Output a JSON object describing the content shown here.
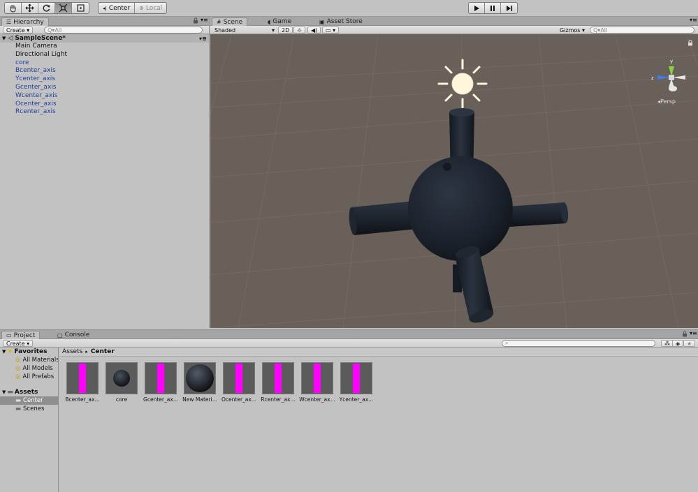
{
  "toolbar": {
    "tools": [
      {
        "name": "hand-tool-button",
        "icon": "hand-icon"
      },
      {
        "name": "move-tool-button",
        "icon": "move-arrows-icon"
      },
      {
        "name": "rotate-tool-button",
        "icon": "rotate-icon"
      },
      {
        "name": "scale-tool-button",
        "icon": "scale-icon"
      },
      {
        "name": "rect-tool-button",
        "icon": "rect-tool-icon"
      }
    ],
    "pivot_label": "Center",
    "space_label": "Local"
  },
  "hierarchy": {
    "tab_label": "Hierarchy",
    "create_label": "Create",
    "search_placeholder": "Q▾All",
    "scene_name": "SampleScene*",
    "items": [
      {
        "label": "Main Camera",
        "prefab": false
      },
      {
        "label": "Directional Light",
        "prefab": false
      },
      {
        "label": "core",
        "prefab": true
      },
      {
        "label": "Bcenter_axis",
        "prefab": true
      },
      {
        "label": "Ycenter_axis",
        "prefab": true
      },
      {
        "label": "Gcenter_axis",
        "prefab": true
      },
      {
        "label": "Wcenter_axis",
        "prefab": true
      },
      {
        "label": "Ocenter_axis",
        "prefab": true
      },
      {
        "label": "Rcenter_axis",
        "prefab": true
      }
    ]
  },
  "scene": {
    "tabs": [
      "Scene",
      "Game",
      "Asset Store"
    ],
    "shading_label": "Shaded",
    "mode_2d_label": "2D",
    "gizmos_label": "Gizmos",
    "search_placeholder": "Q▾All",
    "gizmo": {
      "y_label": "y",
      "z_label": "z",
      "persp_label": "Persp"
    },
    "colors": {
      "background": "#6a605a",
      "grid": "#7a7068",
      "object": "#1c222c",
      "sun": "#fff6dc"
    }
  },
  "project": {
    "tabs": [
      "Project",
      "Console"
    ],
    "create_label": "Create",
    "favorites_label": "Favorites",
    "favorites": [
      "All Materials",
      "All Models",
      "All Prefabs"
    ],
    "assets_label": "Assets",
    "folders": [
      "Center",
      "Scenes"
    ],
    "selected_folder": "Center",
    "breadcrumb": [
      "Assets",
      "Center"
    ],
    "assets": [
      {
        "label": "Bcenter_ax...",
        "kind": "prefab"
      },
      {
        "label": "core",
        "kind": "sphere-small"
      },
      {
        "label": "Gcenter_ax...",
        "kind": "prefab"
      },
      {
        "label": "New Materi...",
        "kind": "sphere-large"
      },
      {
        "label": "Ocenter_ax...",
        "kind": "prefab"
      },
      {
        "label": "Rcenter_ax...",
        "kind": "prefab"
      },
      {
        "label": "Wcenter_ax...",
        "kind": "prefab"
      },
      {
        "label": "Ycenter_ax...",
        "kind": "prefab"
      }
    ]
  }
}
